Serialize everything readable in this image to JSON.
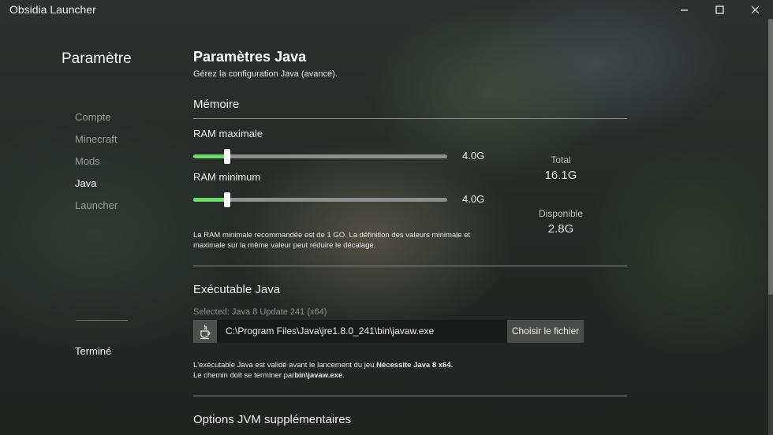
{
  "window": {
    "title": "Obsidia Launcher",
    "controls": {
      "minimize": "–",
      "maximize": "☐",
      "close": "✕"
    }
  },
  "sidebar": {
    "title": "Paramètre",
    "items": [
      {
        "label": "Compte",
        "active": false
      },
      {
        "label": "Minecraft",
        "active": false
      },
      {
        "label": "Mods",
        "active": false
      },
      {
        "label": "Java",
        "active": true
      },
      {
        "label": "Launcher",
        "active": false
      }
    ],
    "done_label": "Terminé"
  },
  "main": {
    "title": "Paramètres Java",
    "subtitle": "Gérez la configuration Java (avancé).",
    "memory": {
      "heading": "Mémoire",
      "ram_max": {
        "label": "RAM maximale",
        "value": "4.0G",
        "fraction": 0.135
      },
      "ram_min": {
        "label": "RAM minimum",
        "value": "4.0G",
        "fraction": 0.135
      },
      "total_label": "Total",
      "total_value": "16.1G",
      "available_label": "Disponible",
      "available_value": "2.8G",
      "note": "La RAM minimale recommandée est de 1 GO. La définition des valeurs minimale et maximale sur la même valeur peut réduire le décalage."
    },
    "executable": {
      "heading": "Exécutable Java",
      "selected": "Selected: Java 8 Update 241 (x64)",
      "path": "C:\\Program Files\\Java\\jre1.8.0_241\\bin\\javaw.exe",
      "choose_button": "Choisir le fichier",
      "note_line1_prefix": "L'exécutable Java est validé avant le lancement du jeu.",
      "note_line1_bold": "Nécessite Java 8 x64.",
      "note_line2_prefix": "Le chemin doit se terminer par",
      "note_line2_bold": "bin\\javaw.exe",
      "note_line2_suffix": "."
    },
    "jvm": {
      "heading": "Options JVM supplémentaires"
    }
  },
  "colors": {
    "slider_fill": "#6fdb6f",
    "slider_track": "#8d8f8c"
  }
}
